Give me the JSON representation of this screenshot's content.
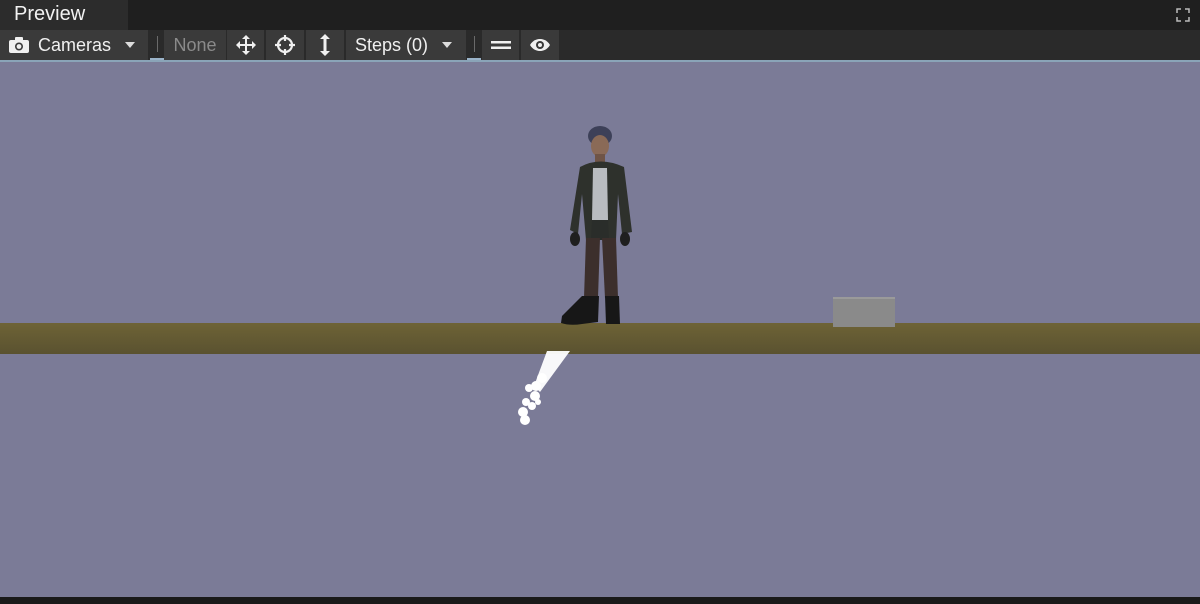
{
  "window": {
    "tab_title": "Preview",
    "maximize_icon": "maximize-icon"
  },
  "toolbar": {
    "cameras_label": "Cameras",
    "none_label": "None",
    "steps_label": "Steps (0)",
    "icons": [
      "camera-icon",
      "move-icon",
      "crosshair-icon",
      "vertical-arrows-icon",
      "equals-icon",
      "eye-icon"
    ]
  },
  "scene": {
    "background_color": "#7b7b97",
    "ground_color": "#665c34",
    "objects": [
      "character",
      "ground-plane",
      "gray-box",
      "particle-effect"
    ]
  }
}
